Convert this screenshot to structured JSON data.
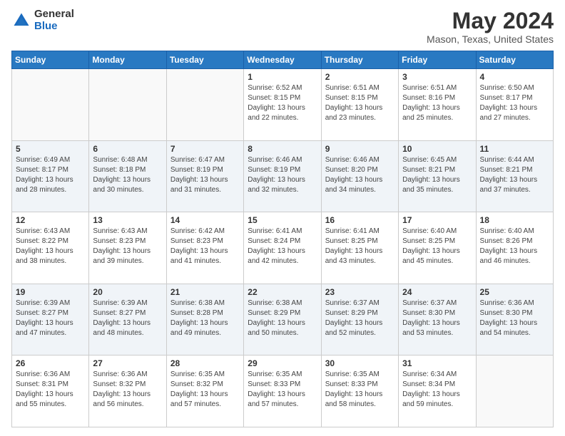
{
  "header": {
    "logo_general": "General",
    "logo_blue": "Blue",
    "title": "May 2024",
    "location": "Mason, Texas, United States"
  },
  "calendar": {
    "days_of_week": [
      "Sunday",
      "Monday",
      "Tuesday",
      "Wednesday",
      "Thursday",
      "Friday",
      "Saturday"
    ],
    "weeks": [
      [
        {
          "day": "",
          "info": ""
        },
        {
          "day": "",
          "info": ""
        },
        {
          "day": "",
          "info": ""
        },
        {
          "day": "1",
          "info": "Sunrise: 6:52 AM\nSunset: 8:15 PM\nDaylight: 13 hours\nand 22 minutes."
        },
        {
          "day": "2",
          "info": "Sunrise: 6:51 AM\nSunset: 8:15 PM\nDaylight: 13 hours\nand 23 minutes."
        },
        {
          "day": "3",
          "info": "Sunrise: 6:51 AM\nSunset: 8:16 PM\nDaylight: 13 hours\nand 25 minutes."
        },
        {
          "day": "4",
          "info": "Sunrise: 6:50 AM\nSunset: 8:17 PM\nDaylight: 13 hours\nand 27 minutes."
        }
      ],
      [
        {
          "day": "5",
          "info": "Sunrise: 6:49 AM\nSunset: 8:17 PM\nDaylight: 13 hours\nand 28 minutes."
        },
        {
          "day": "6",
          "info": "Sunrise: 6:48 AM\nSunset: 8:18 PM\nDaylight: 13 hours\nand 30 minutes."
        },
        {
          "day": "7",
          "info": "Sunrise: 6:47 AM\nSunset: 8:19 PM\nDaylight: 13 hours\nand 31 minutes."
        },
        {
          "day": "8",
          "info": "Sunrise: 6:46 AM\nSunset: 8:19 PM\nDaylight: 13 hours\nand 32 minutes."
        },
        {
          "day": "9",
          "info": "Sunrise: 6:46 AM\nSunset: 8:20 PM\nDaylight: 13 hours\nand 34 minutes."
        },
        {
          "day": "10",
          "info": "Sunrise: 6:45 AM\nSunset: 8:21 PM\nDaylight: 13 hours\nand 35 minutes."
        },
        {
          "day": "11",
          "info": "Sunrise: 6:44 AM\nSunset: 8:21 PM\nDaylight: 13 hours\nand 37 minutes."
        }
      ],
      [
        {
          "day": "12",
          "info": "Sunrise: 6:43 AM\nSunset: 8:22 PM\nDaylight: 13 hours\nand 38 minutes."
        },
        {
          "day": "13",
          "info": "Sunrise: 6:43 AM\nSunset: 8:23 PM\nDaylight: 13 hours\nand 39 minutes."
        },
        {
          "day": "14",
          "info": "Sunrise: 6:42 AM\nSunset: 8:23 PM\nDaylight: 13 hours\nand 41 minutes."
        },
        {
          "day": "15",
          "info": "Sunrise: 6:41 AM\nSunset: 8:24 PM\nDaylight: 13 hours\nand 42 minutes."
        },
        {
          "day": "16",
          "info": "Sunrise: 6:41 AM\nSunset: 8:25 PM\nDaylight: 13 hours\nand 43 minutes."
        },
        {
          "day": "17",
          "info": "Sunrise: 6:40 AM\nSunset: 8:25 PM\nDaylight: 13 hours\nand 45 minutes."
        },
        {
          "day": "18",
          "info": "Sunrise: 6:40 AM\nSunset: 8:26 PM\nDaylight: 13 hours\nand 46 minutes."
        }
      ],
      [
        {
          "day": "19",
          "info": "Sunrise: 6:39 AM\nSunset: 8:27 PM\nDaylight: 13 hours\nand 47 minutes."
        },
        {
          "day": "20",
          "info": "Sunrise: 6:39 AM\nSunset: 8:27 PM\nDaylight: 13 hours\nand 48 minutes."
        },
        {
          "day": "21",
          "info": "Sunrise: 6:38 AM\nSunset: 8:28 PM\nDaylight: 13 hours\nand 49 minutes."
        },
        {
          "day": "22",
          "info": "Sunrise: 6:38 AM\nSunset: 8:29 PM\nDaylight: 13 hours\nand 50 minutes."
        },
        {
          "day": "23",
          "info": "Sunrise: 6:37 AM\nSunset: 8:29 PM\nDaylight: 13 hours\nand 52 minutes."
        },
        {
          "day": "24",
          "info": "Sunrise: 6:37 AM\nSunset: 8:30 PM\nDaylight: 13 hours\nand 53 minutes."
        },
        {
          "day": "25",
          "info": "Sunrise: 6:36 AM\nSunset: 8:30 PM\nDaylight: 13 hours\nand 54 minutes."
        }
      ],
      [
        {
          "day": "26",
          "info": "Sunrise: 6:36 AM\nSunset: 8:31 PM\nDaylight: 13 hours\nand 55 minutes."
        },
        {
          "day": "27",
          "info": "Sunrise: 6:36 AM\nSunset: 8:32 PM\nDaylight: 13 hours\nand 56 minutes."
        },
        {
          "day": "28",
          "info": "Sunrise: 6:35 AM\nSunset: 8:32 PM\nDaylight: 13 hours\nand 57 minutes."
        },
        {
          "day": "29",
          "info": "Sunrise: 6:35 AM\nSunset: 8:33 PM\nDaylight: 13 hours\nand 57 minutes."
        },
        {
          "day": "30",
          "info": "Sunrise: 6:35 AM\nSunset: 8:33 PM\nDaylight: 13 hours\nand 58 minutes."
        },
        {
          "day": "31",
          "info": "Sunrise: 6:34 AM\nSunset: 8:34 PM\nDaylight: 13 hours\nand 59 minutes."
        },
        {
          "day": "",
          "info": ""
        }
      ]
    ]
  }
}
